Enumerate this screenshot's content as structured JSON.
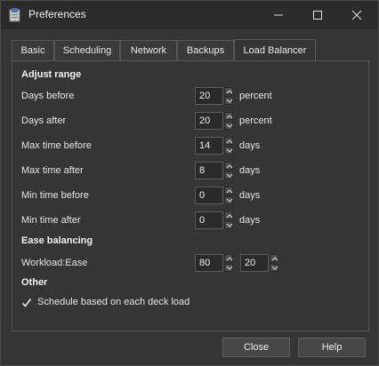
{
  "window": {
    "title": "Preferences"
  },
  "tabs": [
    "Basic",
    "Scheduling",
    "Network",
    "Backups",
    "Load Balancer"
  ],
  "active_tab": "Load Balancer",
  "adjust_range": {
    "heading": "Adjust range",
    "fields": [
      {
        "label": "Days before",
        "value": "20",
        "unit": "percent"
      },
      {
        "label": "Days after",
        "value": "20",
        "unit": "percent"
      },
      {
        "label": "Max time before",
        "value": "14",
        "unit": "days"
      },
      {
        "label": "Max time after",
        "value": "8",
        "unit": "days"
      },
      {
        "label": "Min time before",
        "value": "0",
        "unit": "days"
      },
      {
        "label": "Min time after",
        "value": "0",
        "unit": "days"
      }
    ]
  },
  "ease_balancing": {
    "heading": "Ease balancing",
    "label": "Workload:Ease",
    "workload": "80",
    "ease": "20"
  },
  "other": {
    "heading": "Other",
    "checkbox_label": "Schedule based on each deck load",
    "checked": true
  },
  "buttons": {
    "close": "Close",
    "help": "Help"
  }
}
